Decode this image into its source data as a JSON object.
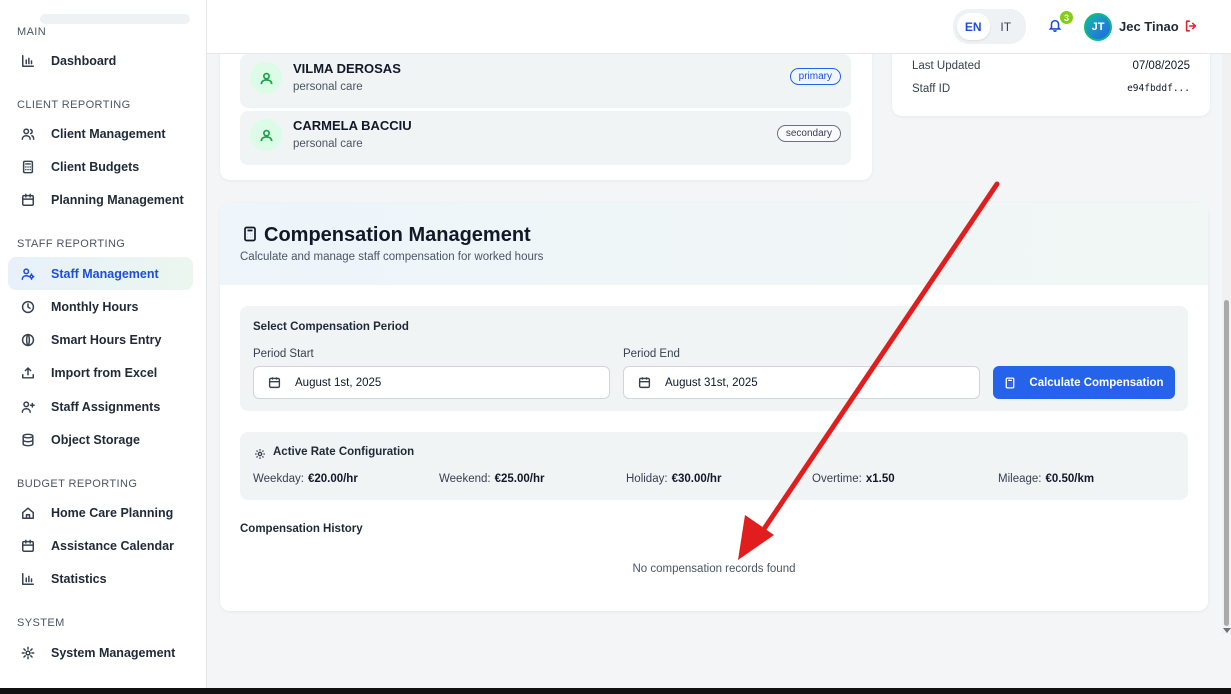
{
  "sidebar": {
    "sections": [
      {
        "label": "MAIN",
        "items": [
          {
            "label": "Dashboard",
            "icon": "bar-chart-icon"
          }
        ]
      },
      {
        "label": "CLIENT REPORTING",
        "items": [
          {
            "label": "Client Management",
            "icon": "users-icon"
          },
          {
            "label": "Client Budgets",
            "icon": "calculator-icon"
          },
          {
            "label": "Planning Management",
            "icon": "calendar-icon"
          }
        ]
      },
      {
        "label": "STAFF REPORTING",
        "items": [
          {
            "label": "Staff Management",
            "icon": "user-cog-icon",
            "active": true
          },
          {
            "label": "Monthly Hours",
            "icon": "clock-icon"
          },
          {
            "label": "Smart Hours Entry",
            "icon": "globe-icon"
          },
          {
            "label": "Import from Excel",
            "icon": "upload-icon"
          },
          {
            "label": "Staff Assignments",
            "icon": "user-plus-icon"
          },
          {
            "label": "Object Storage",
            "icon": "database-icon"
          }
        ]
      },
      {
        "label": "BUDGET REPORTING",
        "items": [
          {
            "label": "Home Care Planning",
            "icon": "home-icon"
          },
          {
            "label": "Assistance Calendar",
            "icon": "calendar-icon"
          },
          {
            "label": "Statistics",
            "icon": "bar-chart-icon"
          }
        ]
      },
      {
        "label": "SYSTEM",
        "items": [
          {
            "label": "System Management",
            "icon": "gear-icon"
          }
        ]
      }
    ]
  },
  "topbar": {
    "languages": [
      "EN",
      "IT"
    ],
    "active_language": "EN",
    "notification_count": "3",
    "user_initials": "JT",
    "user_name": "Jec Tinao"
  },
  "assigned_clients": [
    {
      "name": "VILMA DEROSAS",
      "service": "personal care",
      "role": "primary"
    },
    {
      "name": "CARMELA BACCIU",
      "service": "personal care",
      "role": "secondary"
    }
  ],
  "info": {
    "last_updated_label": "Last Updated",
    "last_updated_value": "07/08/2025",
    "staff_id_label": "Staff ID",
    "staff_id_value": "e94fbddf..."
  },
  "compensation": {
    "title": "Compensation Management",
    "subtitle": "Calculate and manage staff compensation for worked hours",
    "period_section_label": "Select Compensation Period",
    "period_start_label": "Period Start",
    "period_start_value": "August 1st, 2025",
    "period_end_label": "Period End",
    "period_end_value": "August 31st, 2025",
    "calculate_button": "Calculate Compensation",
    "rate_section_label": "Active Rate Configuration",
    "rates": [
      {
        "label": "Weekday:",
        "value": "€20.00/hr"
      },
      {
        "label": "Weekend:",
        "value": "€25.00/hr"
      },
      {
        "label": "Holiday:",
        "value": "€30.00/hr"
      },
      {
        "label": "Overtime:",
        "value": "x1.50"
      },
      {
        "label": "Mileage:",
        "value": "€0.50/km"
      }
    ],
    "history_label": "Compensation History",
    "empty_message": "No compensation records found"
  },
  "colors": {
    "accent": "#2563eb",
    "success": "#16a34a",
    "annotation_arrow": "#e11d1d"
  }
}
